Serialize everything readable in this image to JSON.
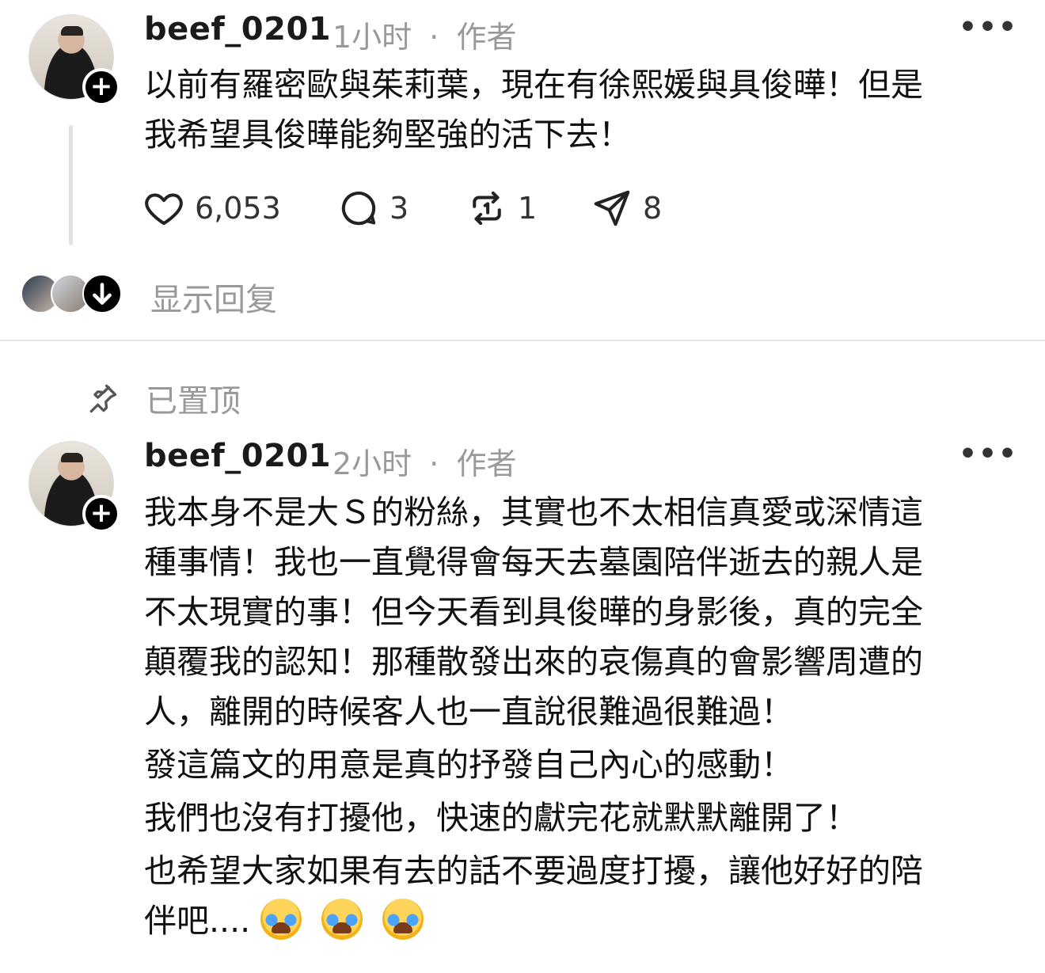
{
  "posts": [
    {
      "username": "beef_0201",
      "time": "1小时",
      "separator": "·",
      "author_tag": "作者",
      "text_lines": [
        "以前有羅密歐與茱莉葉，現在有徐熙媛與具俊曄！但是",
        "我希望具俊曄能夠堅強的活下去！"
      ],
      "likes": "6,053",
      "comments": "3",
      "reposts": "1",
      "shares": "8",
      "show_replies": "显示回复"
    },
    {
      "pinned_label": "已置顶",
      "username": "beef_0201",
      "time": "2小时",
      "separator": "·",
      "author_tag": "作者",
      "text_lines": [
        "我本身不是大Ｓ的粉絲，其實也不太相信真愛或深情這",
        "種事情！我也一直覺得會每天去墓園陪伴逝去的親人是",
        "不太現實的事！但今天看到具俊曄的身影後，真的完全",
        "顛覆我的認知！那種散發出來的哀傷真的會影響周遭的",
        "人，離開的時候客人也一直說很難過很難過！",
        "發這篇文的用意是真的抒發自己內心的感動！",
        "我們也沒有打擾他，快速的獻完花就默默離開了！",
        "也希望大家如果有去的話不要過度打擾，讓他好好的陪",
        "伴吧...."
      ]
    }
  ],
  "icons": {
    "more": "more-dots-icon",
    "follow": "plus-icon",
    "like": "heart-icon",
    "comment": "comment-bubble-icon",
    "repost": "repost-icon",
    "share": "send-icon",
    "pin": "pin-icon",
    "expand": "arrow-down-icon",
    "emoji": "loudly-crying-face-emoji"
  },
  "colors": {
    "text": "#111111",
    "muted": "#999999",
    "divider": "#e6e6e6",
    "thread_line": "#e2e2e2"
  }
}
